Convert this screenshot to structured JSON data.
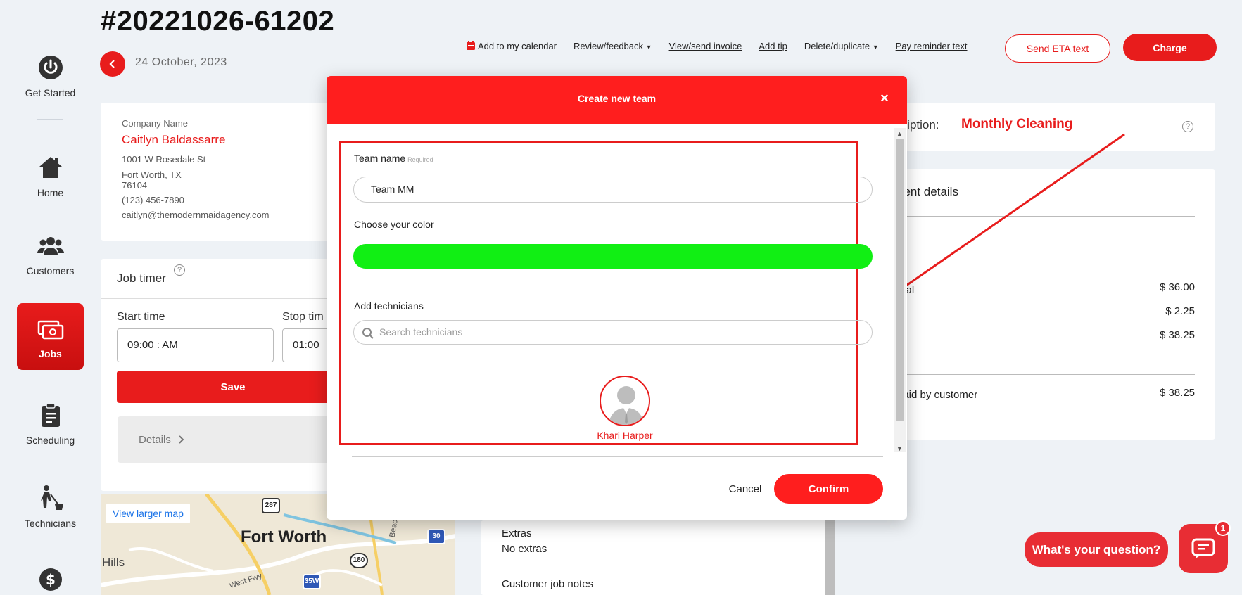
{
  "sidebar": {
    "items": [
      {
        "label": "Get Started",
        "icon": "power-icon"
      },
      {
        "label": "Home",
        "icon": "home-icon"
      },
      {
        "label": "Customers",
        "icon": "users-icon"
      },
      {
        "label": "Jobs",
        "icon": "money-icon",
        "active": true
      },
      {
        "label": "Scheduling",
        "icon": "clipboard-icon"
      },
      {
        "label": "Technicians",
        "icon": "cleaner-icon"
      },
      {
        "label": "",
        "icon": "dollar-icon"
      }
    ]
  },
  "header": {
    "order_number": "#20221026-61202",
    "date": "24 October, 2023",
    "toolbar": {
      "calendar": "Add to my calendar",
      "review": "Review/feedback",
      "invoice": "View/send invoice",
      "tip": "Add tip",
      "delete": "Delete/duplicate",
      "reminder": "Pay reminder text"
    },
    "eta_button": "Send ETA text",
    "charge_button": "Charge"
  },
  "customer": {
    "label": "Company Name",
    "name": "Caitlyn Baldassarre",
    "address1": "1001 W Rosedale St",
    "address2": "Fort Worth, TX",
    "zip": "76104",
    "phone": "(123) 456-7890",
    "email": "caitlyn@themodernmaidagency.com"
  },
  "timer": {
    "title": "Job timer",
    "help": "?",
    "start_label": "Start time",
    "stop_label": "Stop tim",
    "start_value": "09:00 : AM",
    "stop_value": "01:00",
    "save": "Save",
    "details": "Details"
  },
  "map": {
    "link": "View larger map",
    "city": "Fort Worth",
    "area": "Hills",
    "shields": [
      "287",
      "30",
      "180",
      "35W"
    ],
    "roads": [
      "West Fwy",
      "Beach St"
    ]
  },
  "extras": {
    "label": "Extras",
    "value": "No extras",
    "notes_label": "Customer job notes"
  },
  "description": {
    "label": "cription:",
    "value": "Monthly Cleaning",
    "help": "?"
  },
  "payment": {
    "title": "nent details",
    "rows": [
      {
        "label": "otal",
        "amount": "$ 36.00"
      },
      {
        "label": "",
        "amount": "$ 2.25"
      },
      {
        "label": "",
        "amount": "$ 38.25"
      }
    ],
    "paid_label": "paid by customer",
    "paid_amount": "$ 38.25"
  },
  "modal": {
    "title": "Create new team",
    "close": "×",
    "team_name_label": "Team name",
    "required": "Required",
    "team_name_value": "Team MM",
    "color_label": "Choose your color",
    "selected_color": "#11ef14",
    "technicians_label": "Add technicians",
    "search_placeholder": "Search technicians",
    "technician_name": "Khari Harper",
    "cancel": "Cancel",
    "confirm": "Confirm"
  },
  "chat": {
    "prompt": "What's your question?",
    "badge": "1"
  },
  "colors": {
    "brand_red": "#e81c1c",
    "modal_red": "#ff1e1e",
    "background": "#eef2f6"
  }
}
